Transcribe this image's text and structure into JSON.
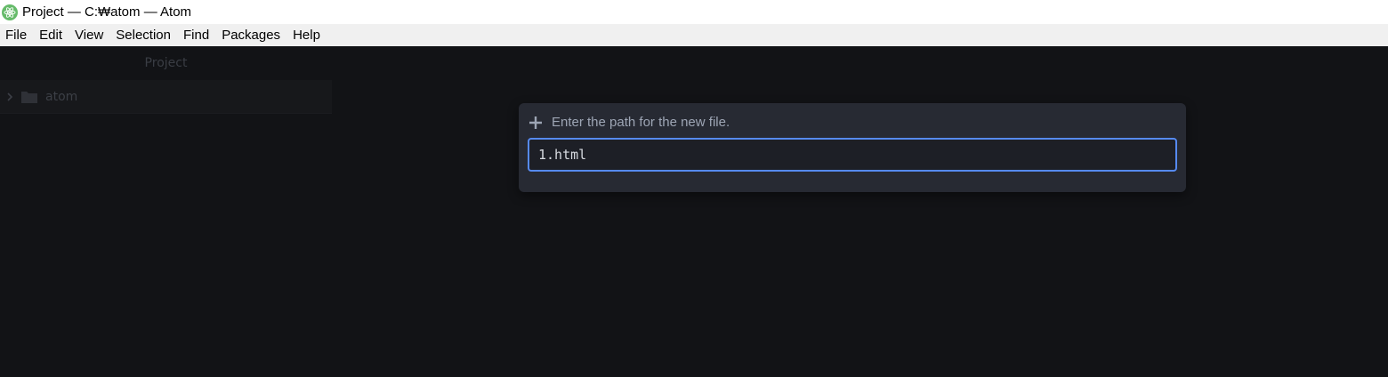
{
  "window": {
    "title": "Project — C:₩atom — Atom",
    "app_icon": "atom-icon"
  },
  "menu": [
    "File",
    "Edit",
    "View",
    "Selection",
    "Find",
    "Packages",
    "Help"
  ],
  "tree_view": {
    "header": "Project",
    "root_folder": {
      "name": "atom",
      "expanded": false,
      "icon": "folder-icon"
    }
  },
  "new_file_dialog": {
    "icon": "plus-icon",
    "prompt": "Enter the path for the new file.",
    "input_value": "1.html"
  },
  "colors": {
    "background": "#121316",
    "dialog": "#272a33",
    "input_border": "#568af2",
    "titlebar": "#ffffff",
    "menubar": "#f0f0f0"
  }
}
